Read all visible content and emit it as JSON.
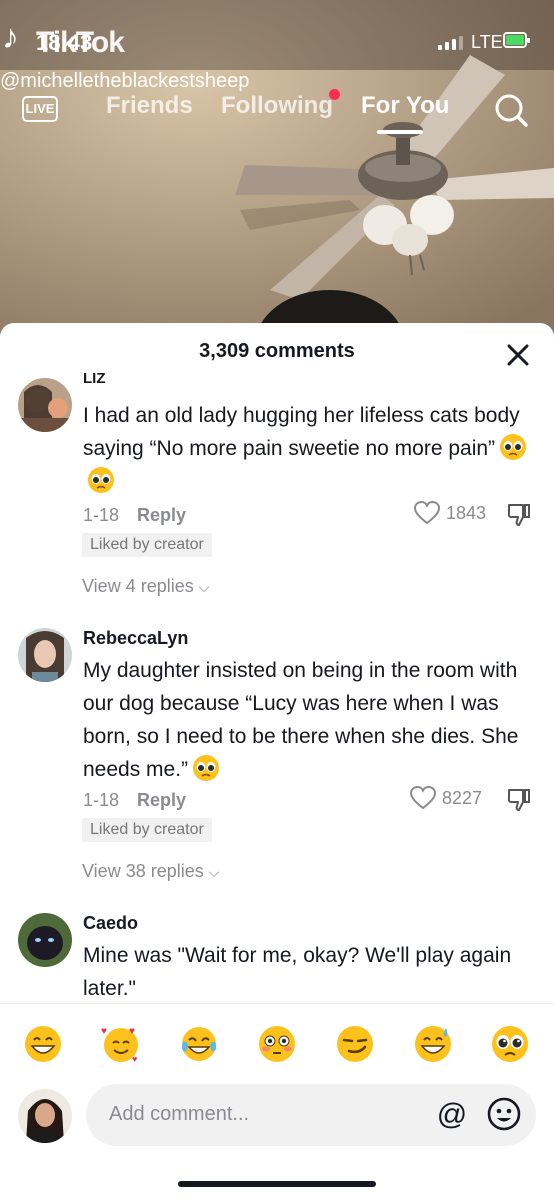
{
  "status": {
    "time": "18:43",
    "app_name": "TikTok",
    "network": "LTE"
  },
  "video": {
    "username": "@michelletheblackestsheep"
  },
  "nav": {
    "live": "LIVE",
    "friends": "Friends",
    "following": "Following",
    "for_you": "For You"
  },
  "comments_panel": {
    "title": "3,309 comments",
    "comments": [
      {
        "name": "Liz",
        "text": "I had an old lady hugging her lifeless cats body saying “No more pain sweetie no more pain”",
        "date": "1-18",
        "reply": "Reply",
        "likes": "1843",
        "badge": "Liked by creator",
        "view_replies": "View 4 replies"
      },
      {
        "name": "RebeccaLyn",
        "text": "My daughter insisted on being in the room with our dog because “Lucy was here when I was born, so I need to be there when she dies. She needs me.”",
        "date": "1-18",
        "reply": "Reply",
        "likes": "8227",
        "badge": "Liked by creator",
        "view_replies": "View 38 replies"
      },
      {
        "name": "Caedo",
        "text": "Mine was \"Wait for me, okay? We'll play again later.\""
      }
    ]
  },
  "emoji_bar": [
    "grinning-face",
    "smiling-face-with-hearts",
    "face-with-tears-of-joy",
    "flushed-face",
    "smirking-face",
    "grinning-face-with-sweat",
    "pleading-face"
  ],
  "composer": {
    "placeholder": "Add comment..."
  },
  "colors": {
    "accent_red": "#fe2c55",
    "text_primary": "#161823",
    "text_secondary": "#8a8b91"
  }
}
